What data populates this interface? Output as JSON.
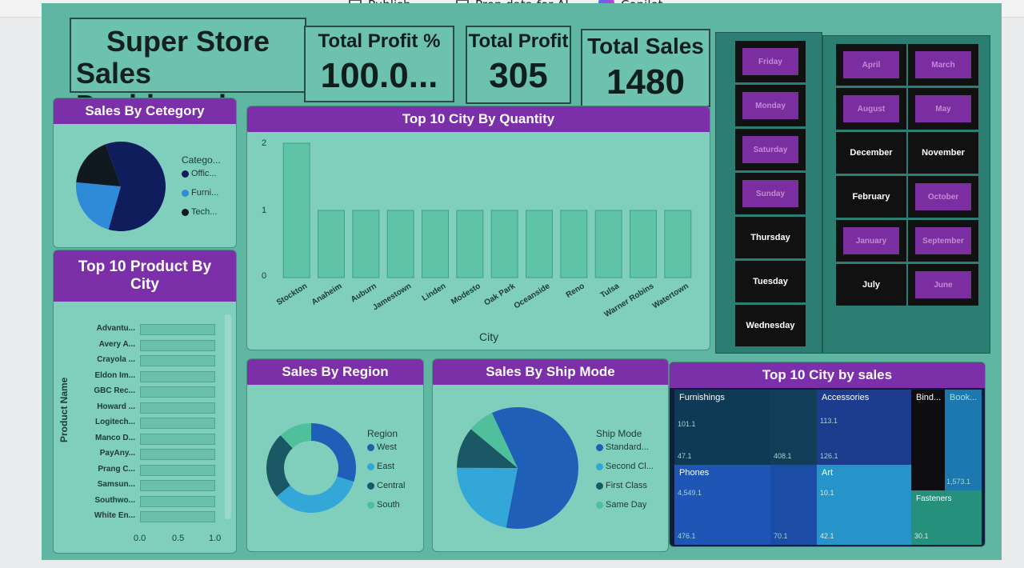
{
  "toolbar": {
    "publish_label": "Publish",
    "prep_label": "Prep data for AI",
    "copilot_label": "Copilot",
    "more_label": "···"
  },
  "header": {
    "title_line1": "Super Store",
    "title_line2": "Sales Dashboard"
  },
  "kpis": [
    {
      "label": "Total Profit %",
      "value": "100.0..."
    },
    {
      "label": "Total Profit",
      "value": "305"
    },
    {
      "label": "Total Sales",
      "value": "1480"
    }
  ],
  "days_slicer": {
    "items": [
      {
        "label": "Friday",
        "selected": true
      },
      {
        "label": "Monday",
        "selected": true
      },
      {
        "label": "Saturday",
        "selected": true
      },
      {
        "label": "Sunday",
        "selected": true
      },
      {
        "label": "Thursday",
        "selected": false
      },
      {
        "label": "Tuesday",
        "selected": false
      },
      {
        "label": "Wednesday",
        "selected": false
      }
    ]
  },
  "months_slicer": {
    "items": [
      {
        "label": "April",
        "selected": true
      },
      {
        "label": "March",
        "selected": true
      },
      {
        "label": "August",
        "selected": true
      },
      {
        "label": "May",
        "selected": true
      },
      {
        "label": "December",
        "selected": false
      },
      {
        "label": "November",
        "selected": false
      },
      {
        "label": "February",
        "selected": false
      },
      {
        "label": "October",
        "selected": true
      },
      {
        "label": "January",
        "selected": true
      },
      {
        "label": "September",
        "selected": true
      },
      {
        "label": "July",
        "selected": false
      },
      {
        "label": "June",
        "selected": true
      }
    ]
  },
  "category_panel": {
    "title": "Sales By Cetegory",
    "legend_title": "Catego...",
    "legend": [
      {
        "label": "Offic...",
        "color": "#0f1d5c"
      },
      {
        "label": "Furni...",
        "color": "#2f8ad8"
      },
      {
        "label": "Tech...",
        "color": "#101820"
      }
    ]
  },
  "product_panel": {
    "title_line1": "Top 10 Product By",
    "title_line2": "City",
    "axis_title": "Product Name",
    "x_ticks": [
      "0.0",
      "0.5",
      "1.0"
    ]
  },
  "city_qty_panel": {
    "title": "Top 10 City By Quantity",
    "x_title": "City",
    "y_ticks": [
      "2",
      "1",
      "0"
    ]
  },
  "region_panel": {
    "title": "Sales By Region",
    "legend_title": "Region",
    "legend": [
      {
        "label": "West",
        "color": "#1f5fb8"
      },
      {
        "label": "East",
        "color": "#34a7d9"
      },
      {
        "label": "Central",
        "color": "#1a5866"
      },
      {
        "label": "South",
        "color": "#4fbf9c"
      }
    ]
  },
  "shipmode_panel": {
    "title": "Sales By Ship Mode",
    "legend_title": "Ship Mode",
    "legend": [
      {
        "label": "Standard...",
        "color": "#1f5fb8"
      },
      {
        "label": "Second Cl...",
        "color": "#34a7d9"
      },
      {
        "label": "First Class",
        "color": "#1a5866"
      },
      {
        "label": "Same Day",
        "color": "#4fbf9c"
      }
    ]
  },
  "treemap_panel": {
    "title": "Top 10 City by sales",
    "labels": {
      "furnishings": "Furnishings",
      "accessories": "Accessories",
      "binders": "Bind...",
      "bookcases": "Book...",
      "phones": "Phones",
      "art": "Art",
      "fasteners": "Fasteners"
    },
    "values": {
      "furn_a": "101.1",
      "furn_b": "47.1",
      "furn_c": "408.1",
      "acc_a": "113.1",
      "acc_b": "126.1",
      "book_a": "1,573.1",
      "phones_a": "4,549.1",
      "phones_b": "476.1",
      "phones_c": "70.1",
      "art_a": "10.1",
      "art_b": "42.1",
      "fast_a": "30.1"
    }
  },
  "chart_data": [
    {
      "type": "bar",
      "title": "Top 10 City By Quantity",
      "xlabel": "City",
      "ylabel": "",
      "categories": [
        "Stockton",
        "Anaheim",
        "Auburn",
        "Jamestown",
        "Linden",
        "Modesto",
        "Oak Park",
        "Oceanside",
        "Reno",
        "Tulsa",
        "Warner Robins",
        "Watertown"
      ],
      "values": [
        2,
        1,
        1,
        1,
        1,
        1,
        1,
        1,
        1,
        1,
        1,
        1
      ],
      "ylim": [
        0,
        2
      ]
    },
    {
      "type": "bar",
      "title": "Top 10 Product By City",
      "ylabel": "Product Name",
      "categories": [
        "Advantu...",
        "Avery A...",
        "Crayola ...",
        "Eldon Im...",
        "GBC Rec...",
        "Howard ...",
        "Logitech...",
        "Manco D...",
        "PayAny...",
        "Prang C...",
        "Samsun...",
        "Southwo...",
        "White En..."
      ],
      "values": [
        1,
        1,
        1,
        1,
        1,
        1,
        1,
        1,
        1,
        1,
        1,
        1,
        1
      ],
      "xlim": [
        0,
        1
      ]
    },
    {
      "type": "pie",
      "title": "Sales By Cetegory",
      "labels": [
        "Offic...",
        "Furni...",
        "Tech..."
      ],
      "values": [
        60,
        22,
        18
      ]
    },
    {
      "type": "pie",
      "title": "Sales By Region",
      "labels": [
        "West",
        "East",
        "Central",
        "South"
      ],
      "values": [
        30,
        34,
        24,
        12
      ]
    },
    {
      "type": "pie",
      "title": "Sales By Ship Mode",
      "labels": [
        "Standard...",
        "Second Cl...",
        "First Class",
        "Same Day"
      ],
      "values": [
        60,
        22,
        11,
        7
      ]
    }
  ]
}
